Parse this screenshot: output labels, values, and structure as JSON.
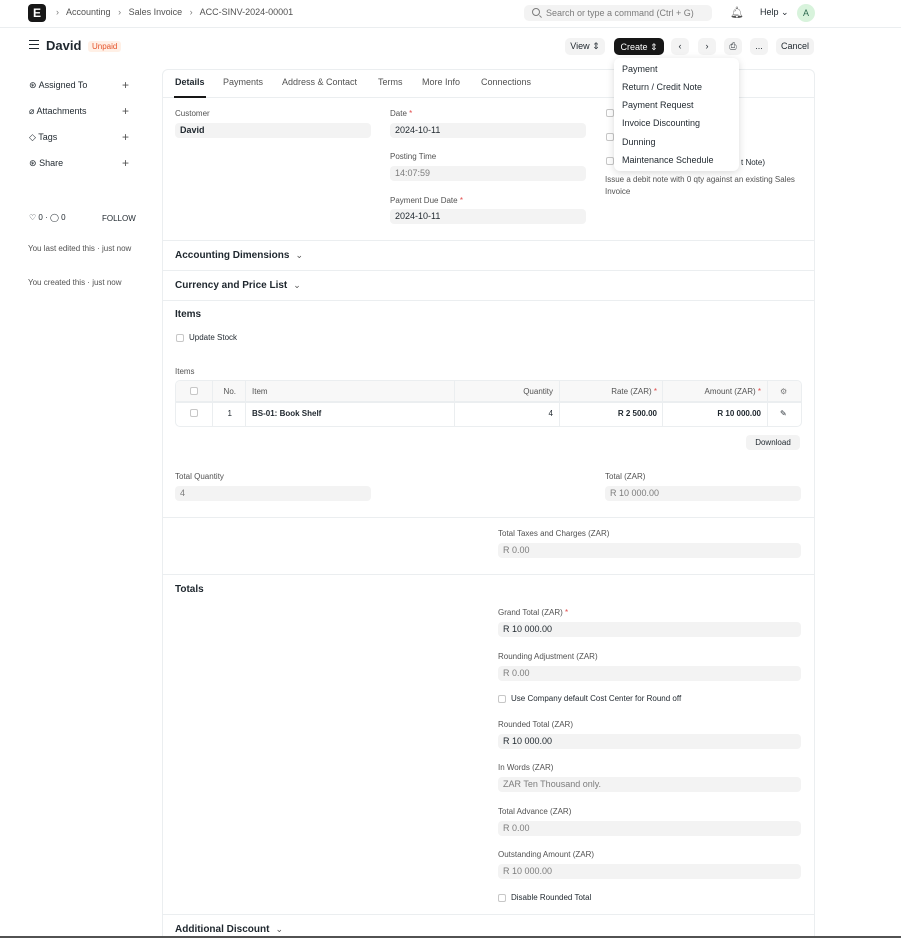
{
  "navbar": {
    "logo": "E",
    "breadcrumbs": [
      "Accounting",
      "Sales Invoice",
      "ACC-SINV-2024-00001"
    ],
    "search_placeholder": "Search or type a command (Ctrl + G)",
    "help": "Help",
    "avatar": "A"
  },
  "header": {
    "title": "David",
    "status": "Unpaid",
    "view_label": "View",
    "create_label": "Create",
    "more_label": "...",
    "cancel_label": "Cancel"
  },
  "create_menu": [
    "Payment",
    "Return / Credit Note",
    "Payment Request",
    "Invoice Discounting",
    "Dunning",
    "Maintenance Schedule"
  ],
  "sidebar": {
    "items": [
      "Assigned To",
      "Attachments",
      "Tags",
      "Share"
    ],
    "likes": "0",
    "comments": "0",
    "follow": "FOLLOW",
    "last_edited": "You last edited this · just now",
    "created": "You created this · just now"
  },
  "tabs": [
    "Details",
    "Payments",
    "Address & Contact",
    "Terms",
    "More Info",
    "Connections"
  ],
  "details": {
    "customer_label": "Customer",
    "customer": "David",
    "date_label": "Date",
    "date": "2024-10-11",
    "posting_time_label": "Posting Time",
    "posting_time": "14:07:59",
    "due_date_label": "Payment Due Date",
    "due_date": "2024-10-11",
    "debit_note_partial": "t Note)",
    "debit_note_help": "Issue a debit note with 0 qty against an existing Sales Invoice"
  },
  "sections": {
    "accounting_dimensions": "Accounting Dimensions",
    "currency_price_list": "Currency and Price List",
    "items": "Items",
    "totals": "Totals",
    "additional_discount": "Additional Discount"
  },
  "items": {
    "update_stock": "Update Stock",
    "grid_label": "Items",
    "columns": [
      "No.",
      "Item",
      "Quantity",
      "Rate (ZAR)",
      "Amount (ZAR)"
    ],
    "rows": [
      {
        "no": "1",
        "item": "BS-01: Book Shelf",
        "qty": "4",
        "rate": "R 2 500.00",
        "amount": "R 10 000.00"
      }
    ],
    "download": "Download",
    "total_qty_label": "Total Quantity",
    "total_qty": "4",
    "total_label": "Total (ZAR)",
    "total": "R 10 000.00",
    "taxes_label": "Total Taxes and Charges (ZAR)",
    "taxes": "R 0.00"
  },
  "totals": {
    "grand_total_label": "Grand Total (ZAR)",
    "grand_total": "R 10 000.00",
    "rounding_label": "Rounding Adjustment (ZAR)",
    "rounding": "R 0.00",
    "use_cost_center": "Use Company default Cost Center for Round off",
    "rounded_total_label": "Rounded Total (ZAR)",
    "rounded_total": "R 10 000.00",
    "in_words_label": "In Words (ZAR)",
    "in_words": "ZAR Ten Thousand only.",
    "advance_label": "Total Advance (ZAR)",
    "advance": "R 0.00",
    "outstanding_label": "Outstanding Amount (ZAR)",
    "outstanding": "R 10 000.00",
    "disable_rounded": "Disable Rounded Total"
  },
  "colors": {
    "accent": "#171717",
    "status": "#e5532a"
  }
}
